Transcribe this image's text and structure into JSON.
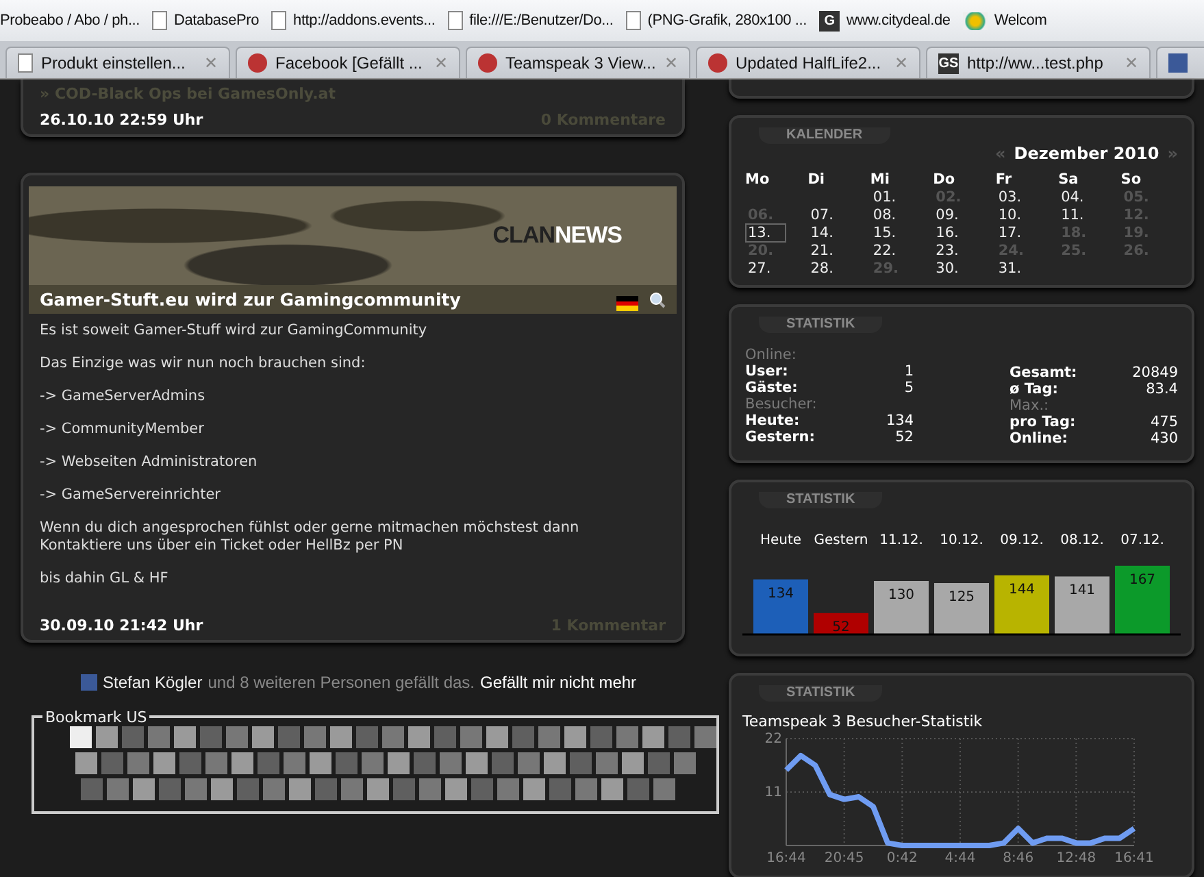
{
  "browser": {
    "bookmarks": [
      {
        "kind": "none",
        "label": "Probeabo / Abo / ph..."
      },
      {
        "kind": "page",
        "label": "DatabasePro"
      },
      {
        "kind": "page",
        "label": "http://addons.events..."
      },
      {
        "kind": "page",
        "label": "file:///E:/Benutzer/Do..."
      },
      {
        "kind": "page",
        "label": "(PNG-Grafik, 280x100 ..."
      },
      {
        "kind": "letter",
        "favicon_text": "G",
        "label": "www.citydeal.de"
      },
      {
        "kind": "logo",
        "label": "Welcom"
      }
    ],
    "tabs": [
      {
        "kind": "page",
        "label": "Produkt einstellen...",
        "close": "✕"
      },
      {
        "kind": "mp",
        "label": "Facebook [Gefällt ...",
        "close": "✕"
      },
      {
        "kind": "mp",
        "label": "Teamspeak 3 View...",
        "close": "✕"
      },
      {
        "kind": "mp",
        "label": "Updated HalfLife2...",
        "close": "✕"
      },
      {
        "kind": "letter",
        "favicon_text": "GS",
        "label": "http://ww...test.php",
        "close": "✕"
      },
      {
        "kind": "facebook"
      }
    ]
  },
  "previous_post": {
    "marker": "»",
    "link": "COD-Black Ops bei GamesOnly.at",
    "date": "26.10.10 22:59 Uhr",
    "comments": "0 Kommentare"
  },
  "news": {
    "logo_dark": "CLAN",
    "logo_light": "NEWS",
    "title": "Gamer-Stuft.eu wird zur Gamingcommunity",
    "paragraphs": [
      "Es ist soweit Gamer-Stuff wird zur GamingCommunity",
      "Das Einzige was wir nun noch brauchen sind:",
      "-> GameServerAdmins",
      "-> CommunityMember",
      "-> Webseiten Administratoren",
      "-> GameServereinrichter",
      "Wenn du dich angesprochen fühlst oder gerne mitmachen möchstest dann Kontaktiere uns über ein Ticket oder HellBz per PN",
      "bis dahin GL & HF"
    ],
    "date": "30.09.10 21:42 Uhr",
    "comments": "1 Kommentar"
  },
  "facebook_like": {
    "name": "Stefan Kögler",
    "text": "und 8 weiteren Personen gefällt das.",
    "action": "Gefällt mir nicht mehr"
  },
  "bookmark_us": {
    "title": "Bookmark US"
  },
  "calendar": {
    "tab": "KALENDER",
    "prev": "«",
    "month": "Dezember 2010",
    "next": "»",
    "weekdays": [
      "Mo",
      "Di",
      "Mi",
      "Do",
      "Fr",
      "Sa",
      "So"
    ],
    "weeks": [
      {
        "days": [
          {
            "label": "01.",
            "dim": false,
            "selected": false
          },
          {
            "label": "02.",
            "dim": true,
            "selected": false
          },
          {
            "label": "03.",
            "dim": false,
            "selected": false
          },
          {
            "label": "04.",
            "dim": false,
            "selected": false
          },
          {
            "label": "05.",
            "dim": true,
            "selected": false
          }
        ]
      },
      {
        "days": [
          {
            "label": "06.",
            "dim": true,
            "selected": false
          },
          {
            "label": "07.",
            "dim": false,
            "selected": false
          },
          {
            "label": "08.",
            "dim": false,
            "selected": false
          },
          {
            "label": "09.",
            "dim": false,
            "selected": false
          },
          {
            "label": "10.",
            "dim": false,
            "selected": false
          },
          {
            "label": "11.",
            "dim": false,
            "selected": false
          },
          {
            "label": "12.",
            "dim": true,
            "selected": false
          }
        ]
      },
      {
        "days": [
          {
            "label": "13.",
            "dim": false,
            "selected": true
          },
          {
            "label": "14.",
            "dim": false,
            "selected": false
          },
          {
            "label": "15.",
            "dim": false,
            "selected": false
          },
          {
            "label": "16.",
            "dim": false,
            "selected": false
          },
          {
            "label": "17.",
            "dim": false,
            "selected": false
          },
          {
            "label": "18.",
            "dim": true,
            "selected": false
          },
          {
            "label": "19.",
            "dim": true,
            "selected": false
          }
        ]
      },
      {
        "days": [
          {
            "label": "20.",
            "dim": true,
            "selected": false
          },
          {
            "label": "21.",
            "dim": false,
            "selected": false
          },
          {
            "label": "22.",
            "dim": false,
            "selected": false
          },
          {
            "label": "23.",
            "dim": false,
            "selected": false
          },
          {
            "label": "24.",
            "dim": true,
            "selected": false
          },
          {
            "label": "25.",
            "dim": true,
            "selected": false
          },
          {
            "label": "26.",
            "dim": true,
            "selected": false
          }
        ]
      },
      {
        "days": [
          {
            "label": "27.",
            "dim": false,
            "selected": false
          },
          {
            "label": "28.",
            "dim": false,
            "selected": false
          },
          {
            "label": "29.",
            "dim": true,
            "selected": false
          },
          {
            "label": "30.",
            "dim": false,
            "selected": false
          },
          {
            "label": "31.",
            "dim": false,
            "selected": false
          }
        ]
      }
    ]
  },
  "statistics": {
    "tab": "STATISTIK",
    "columns": [
      {
        "items": [
          {
            "kind": "heading",
            "label": "Online:"
          },
          {
            "kind": "row",
            "label": "User:",
            "value": "1"
          },
          {
            "kind": "row",
            "label": "Gäste:",
            "value": "5"
          },
          {
            "kind": "heading",
            "label": "Besucher:"
          },
          {
            "kind": "row",
            "label": "Heute:",
            "value": "134"
          },
          {
            "kind": "row",
            "label": "Gestern:",
            "value": "52"
          }
        ]
      },
      {
        "items": [
          {
            "kind": "row",
            "label": "Gesamt:",
            "value": "20849"
          },
          {
            "kind": "row",
            "label": "ø Tag:",
            "value": "83.4"
          },
          {
            "kind": "heading",
            "label": "Max.:"
          },
          {
            "kind": "row",
            "label": "pro Tag:",
            "value": "475"
          },
          {
            "kind": "row",
            "label": "Online:",
            "value": "430"
          }
        ]
      }
    ]
  },
  "visitor_bars": {
    "tab": "STATISTIK",
    "chart_data": {
      "type": "bar",
      "categories": [
        "Heute",
        "Gestern",
        "11.12.",
        "10.12.",
        "09.12.",
        "08.12.",
        "07.12."
      ],
      "stacked": true,
      "data_labels": true,
      "series": [
        {
          "color": "#1d5fb8",
          "values": [
            134,
            null,
            null,
            null,
            null,
            null,
            null
          ]
        },
        {
          "color": "#b00000",
          "values": [
            null,
            52,
            null,
            null,
            null,
            null,
            null
          ]
        },
        {
          "color": "#a8a8a8",
          "values": [
            null,
            null,
            130,
            125,
            null,
            141,
            null
          ]
        },
        {
          "color": "#b8b400",
          "values": [
            null,
            null,
            null,
            null,
            144,
            null,
            null
          ]
        },
        {
          "color": "#0c9a2a",
          "values": [
            null,
            null,
            null,
            null,
            null,
            null,
            167
          ]
        }
      ]
    }
  },
  "teamspeak": {
    "tab": "STATISTIK",
    "chart_data": {
      "type": "line",
      "title": "Teamspeak 3 Besucher-Statistik",
      "categories": [
        "16:44",
        null,
        null,
        null,
        "20:45",
        null,
        null,
        null,
        "0:42",
        null,
        null,
        null,
        "4:44",
        null,
        null,
        null,
        "8:46",
        null,
        null,
        null,
        "12:48",
        null,
        null,
        null,
        "16:41"
      ],
      "series": [
        {
          "color": "#6f9cf2",
          "values": [
            15.5,
            18.5,
            16.5,
            10.5,
            9.5,
            10,
            8,
            0.5,
            0,
            0,
            0,
            0,
            0,
            0,
            0,
            0.5,
            3.5,
            0.5,
            1.5,
            1.5,
            0.5,
            0.5,
            1.5,
            1.5,
            3.5
          ]
        }
      ],
      "grid": true,
      "ylim": [
        0,
        22
      ],
      "yticks": [
        {
          "value": 11,
          "label": "11"
        },
        {
          "value": 22,
          "label": "22"
        }
      ]
    }
  }
}
